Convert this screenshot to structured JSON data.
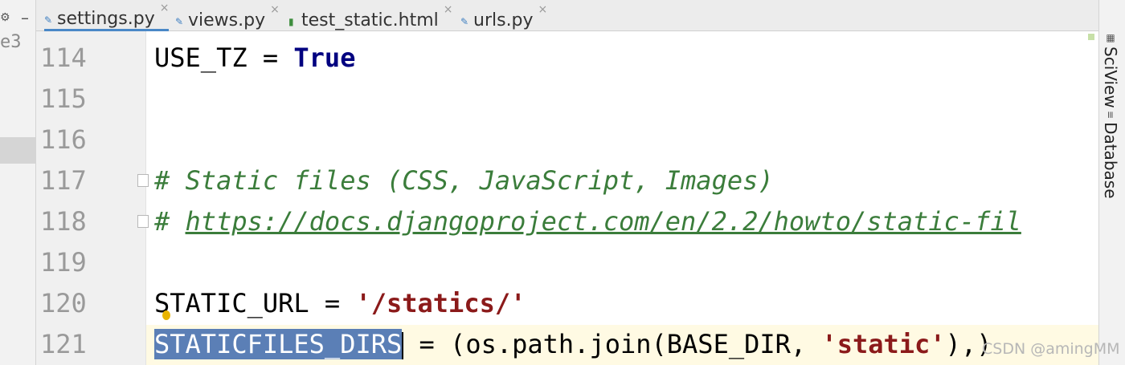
{
  "left_panel": {
    "gear_icon": "gear-icon",
    "collapse_icon": "minus-icon",
    "truncated_text": "e3"
  },
  "tabs": [
    {
      "label": "settings.py",
      "type": "py",
      "active": true
    },
    {
      "label": "views.py",
      "type": "py",
      "active": false
    },
    {
      "label": "test_static.html",
      "type": "html",
      "active": false
    },
    {
      "label": "urls.py",
      "type": "py",
      "active": false
    }
  ],
  "tab_close_glyph": "×",
  "lines": [
    {
      "number": "114"
    },
    {
      "number": "115"
    },
    {
      "number": "116"
    },
    {
      "number": "117"
    },
    {
      "number": "118"
    },
    {
      "number": "119"
    },
    {
      "number": "120"
    },
    {
      "number": "121"
    }
  ],
  "code": {
    "l114_a": "USE_TZ = ",
    "l114_kw": "True",
    "l117_comment": "# Static files (CSS, JavaScript, Images)",
    "l118_hash": "# ",
    "l118_url": "https://docs.djangoproject.com/en/2.2/howto/static-fil",
    "l120_a": "STATIC_URL = ",
    "l120_str": "'/statics/'",
    "l121_selected": "STATICFILES_DIRS",
    "l121_b": " = (os.path.join(BASE_DIR, ",
    "l121_str": "'static'",
    "l121_c": "),)"
  },
  "right_panel": {
    "sciview_label": "SciView",
    "database_label": "Database"
  },
  "watermark": "CSDN @amingMM",
  "colors": {
    "keyword": "#000080",
    "string": "#8b1a1a",
    "comment": "#3b7d3b",
    "selection": "#5b7fb6",
    "current_line": "#fffae3",
    "active_tab_underline": "#4a88c7"
  }
}
